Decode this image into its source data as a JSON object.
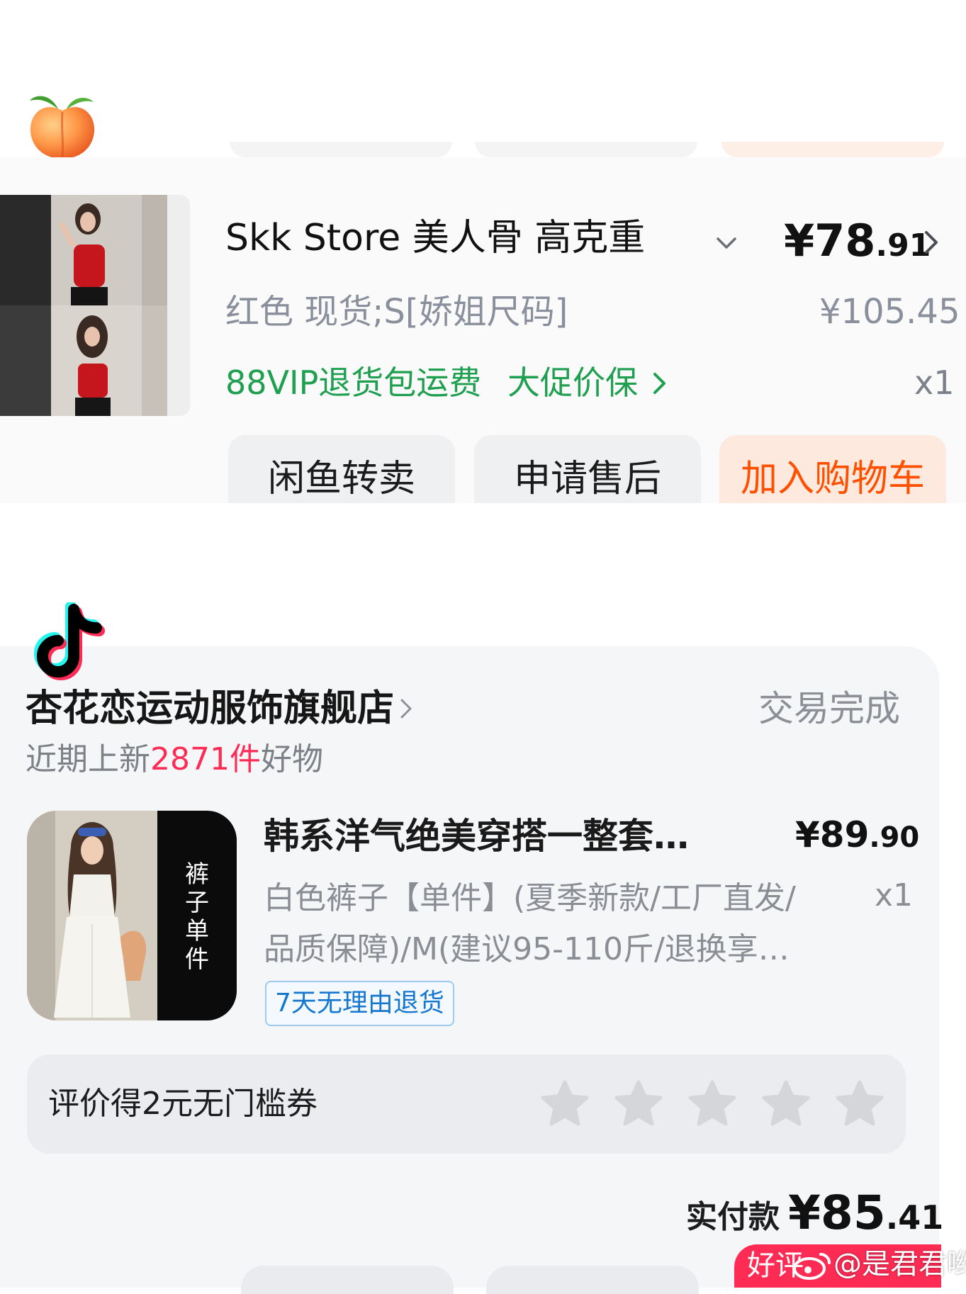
{
  "taobao": {
    "app_icon": "peach-icon",
    "product": {
      "title": "Skk Store 美人骨 高克重",
      "price_main": "¥78",
      "price_decimal": ".91",
      "spec": "红色 现货;S[娇姐尺码]",
      "original_price": "¥105.45",
      "service": "88VIP退货包运费",
      "promo": "大促价保",
      "quantity": "x1"
    },
    "buttons": {
      "resell": "闲鱼转卖",
      "after_sale": "申请售后",
      "add_cart": "加入购物车"
    },
    "colors": {
      "accent": "#ff5000",
      "service_green": "#1fa050"
    }
  },
  "douyin": {
    "app_icon": "tiktok-icon",
    "store_name": "杏花恋运动服饰旗舰店",
    "order_status": "交易完成",
    "new_arrivals": {
      "prefix": "近期上新",
      "count": "2871件",
      "suffix": "好物"
    },
    "product": {
      "thumb_tag": "裤子单件",
      "title": "韩系洋气绝美穿搭一整套…",
      "price_main": "¥89",
      "price_decimal": ".90",
      "spec_line1": "白色裤子【单件】(夏季新款/工厂直发/",
      "spec_line2": "品质保障)/M(建议95-110斤/退换享…",
      "quantity": "x1",
      "return_badge": "7天无理由退货"
    },
    "review": {
      "text": "评价得2元无门槛券",
      "rating": 0,
      "max_rating": 5
    },
    "payment": {
      "label": "实付款",
      "amount_main": "¥85",
      "amount_decimal": ".41"
    },
    "good_review_button": "好评",
    "colors": {
      "accent": "#fe2c55",
      "badge_blue": "#1677cf"
    }
  },
  "watermark": "@是君君哟"
}
